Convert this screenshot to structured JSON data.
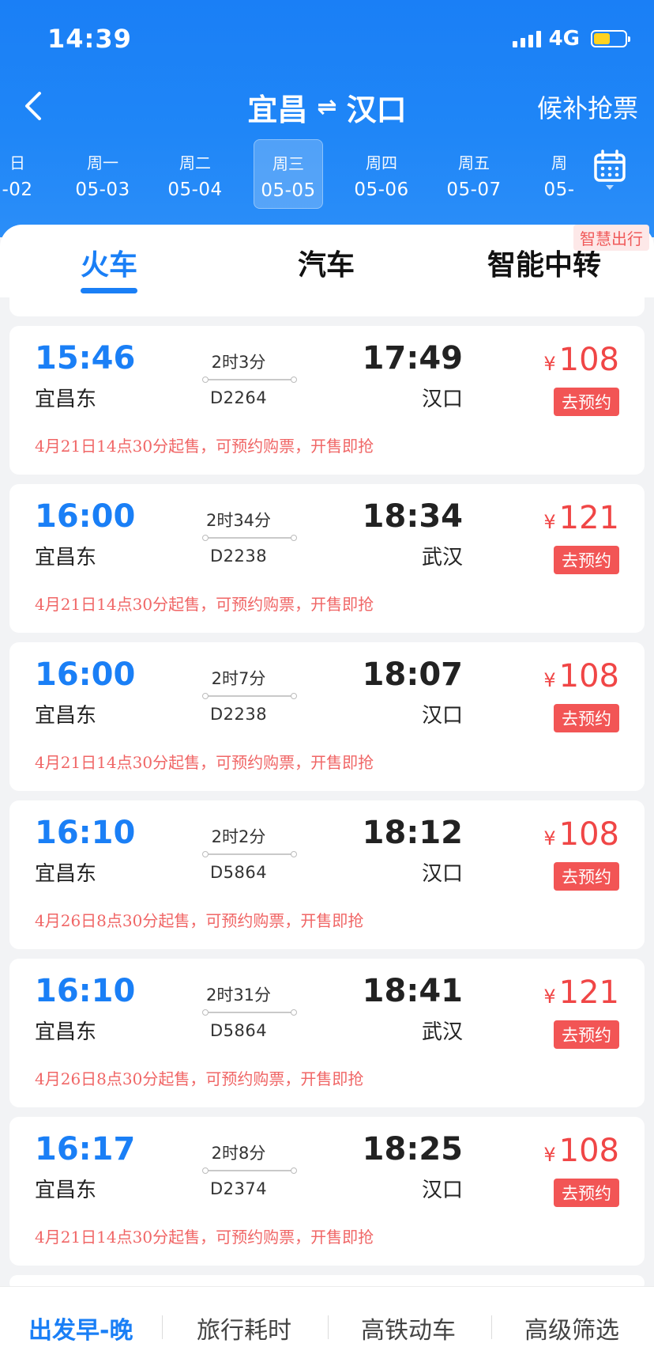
{
  "status_bar": {
    "time": "14:39",
    "network": "4G"
  },
  "nav": {
    "from": "宜昌",
    "swap_glyph": "⇌",
    "to": "汉口",
    "right_action": "候补抢票"
  },
  "dates": [
    {
      "weekday": "日",
      "date": "-02"
    },
    {
      "weekday": "周一",
      "date": "05-03"
    },
    {
      "weekday": "周二",
      "date": "05-04"
    },
    {
      "weekday": "周三",
      "date": "05-05"
    },
    {
      "weekday": "周四",
      "date": "05-06"
    },
    {
      "weekday": "周五",
      "date": "05-07"
    },
    {
      "weekday": "周",
      "date": "05-"
    }
  ],
  "selected_date_index": 3,
  "tabs": {
    "train": "火车",
    "bus": "汽车",
    "transfer": "智能中转",
    "smart_badge": "智慧出行"
  },
  "trains": [
    {
      "dep_time": "15:46",
      "dep_station": "宜昌东",
      "duration": "2时3分",
      "train_no": "D2264",
      "arr_time": "17:49",
      "arr_station": "汉口",
      "currency": "¥",
      "price": "108",
      "action": "去预约",
      "note": "4月21日14点30分起售，可预约购票，开售即抢"
    },
    {
      "dep_time": "16:00",
      "dep_station": "宜昌东",
      "duration": "2时34分",
      "train_no": "D2238",
      "arr_time": "18:34",
      "arr_station": "武汉",
      "currency": "¥",
      "price": "121",
      "action": "去预约",
      "note": "4月21日14点30分起售，可预约购票，开售即抢"
    },
    {
      "dep_time": "16:00",
      "dep_station": "宜昌东",
      "duration": "2时7分",
      "train_no": "D2238",
      "arr_time": "18:07",
      "arr_station": "汉口",
      "currency": "¥",
      "price": "108",
      "action": "去预约",
      "note": "4月21日14点30分起售，可预约购票，开售即抢"
    },
    {
      "dep_time": "16:10",
      "dep_station": "宜昌东",
      "duration": "2时2分",
      "train_no": "D5864",
      "arr_time": "18:12",
      "arr_station": "汉口",
      "currency": "¥",
      "price": "108",
      "action": "去预约",
      "note": "4月26日8点30分起售，可预约购票，开售即抢"
    },
    {
      "dep_time": "16:10",
      "dep_station": "宜昌东",
      "duration": "2时31分",
      "train_no": "D5864",
      "arr_time": "18:41",
      "arr_station": "武汉",
      "currency": "¥",
      "price": "121",
      "action": "去预约",
      "note": "4月26日8点30分起售，可预约购票，开售即抢"
    },
    {
      "dep_time": "16:17",
      "dep_station": "宜昌东",
      "duration": "2时8分",
      "train_no": "D2374",
      "arr_time": "18:25",
      "arr_station": "汉口",
      "currency": "¥",
      "price": "108",
      "action": "去预约",
      "note": "4月21日14点30分起售，可预约购票，开售即抢"
    }
  ],
  "bottom_filters": {
    "sort": "出发早-晚",
    "duration": "旅行耗时",
    "high_speed": "高铁动车",
    "advanced": "高级筛选"
  },
  "icons": {
    "back": "chevron-left-icon",
    "swap": "swap-arrows-icon",
    "calendar": "calendar-icon",
    "signal": "signal-icon",
    "battery": "battery-icon"
  },
  "colors": {
    "header_blue": "#1a7ff6",
    "price_red": "#f04646",
    "badge_yellow": "#ffd21f"
  }
}
